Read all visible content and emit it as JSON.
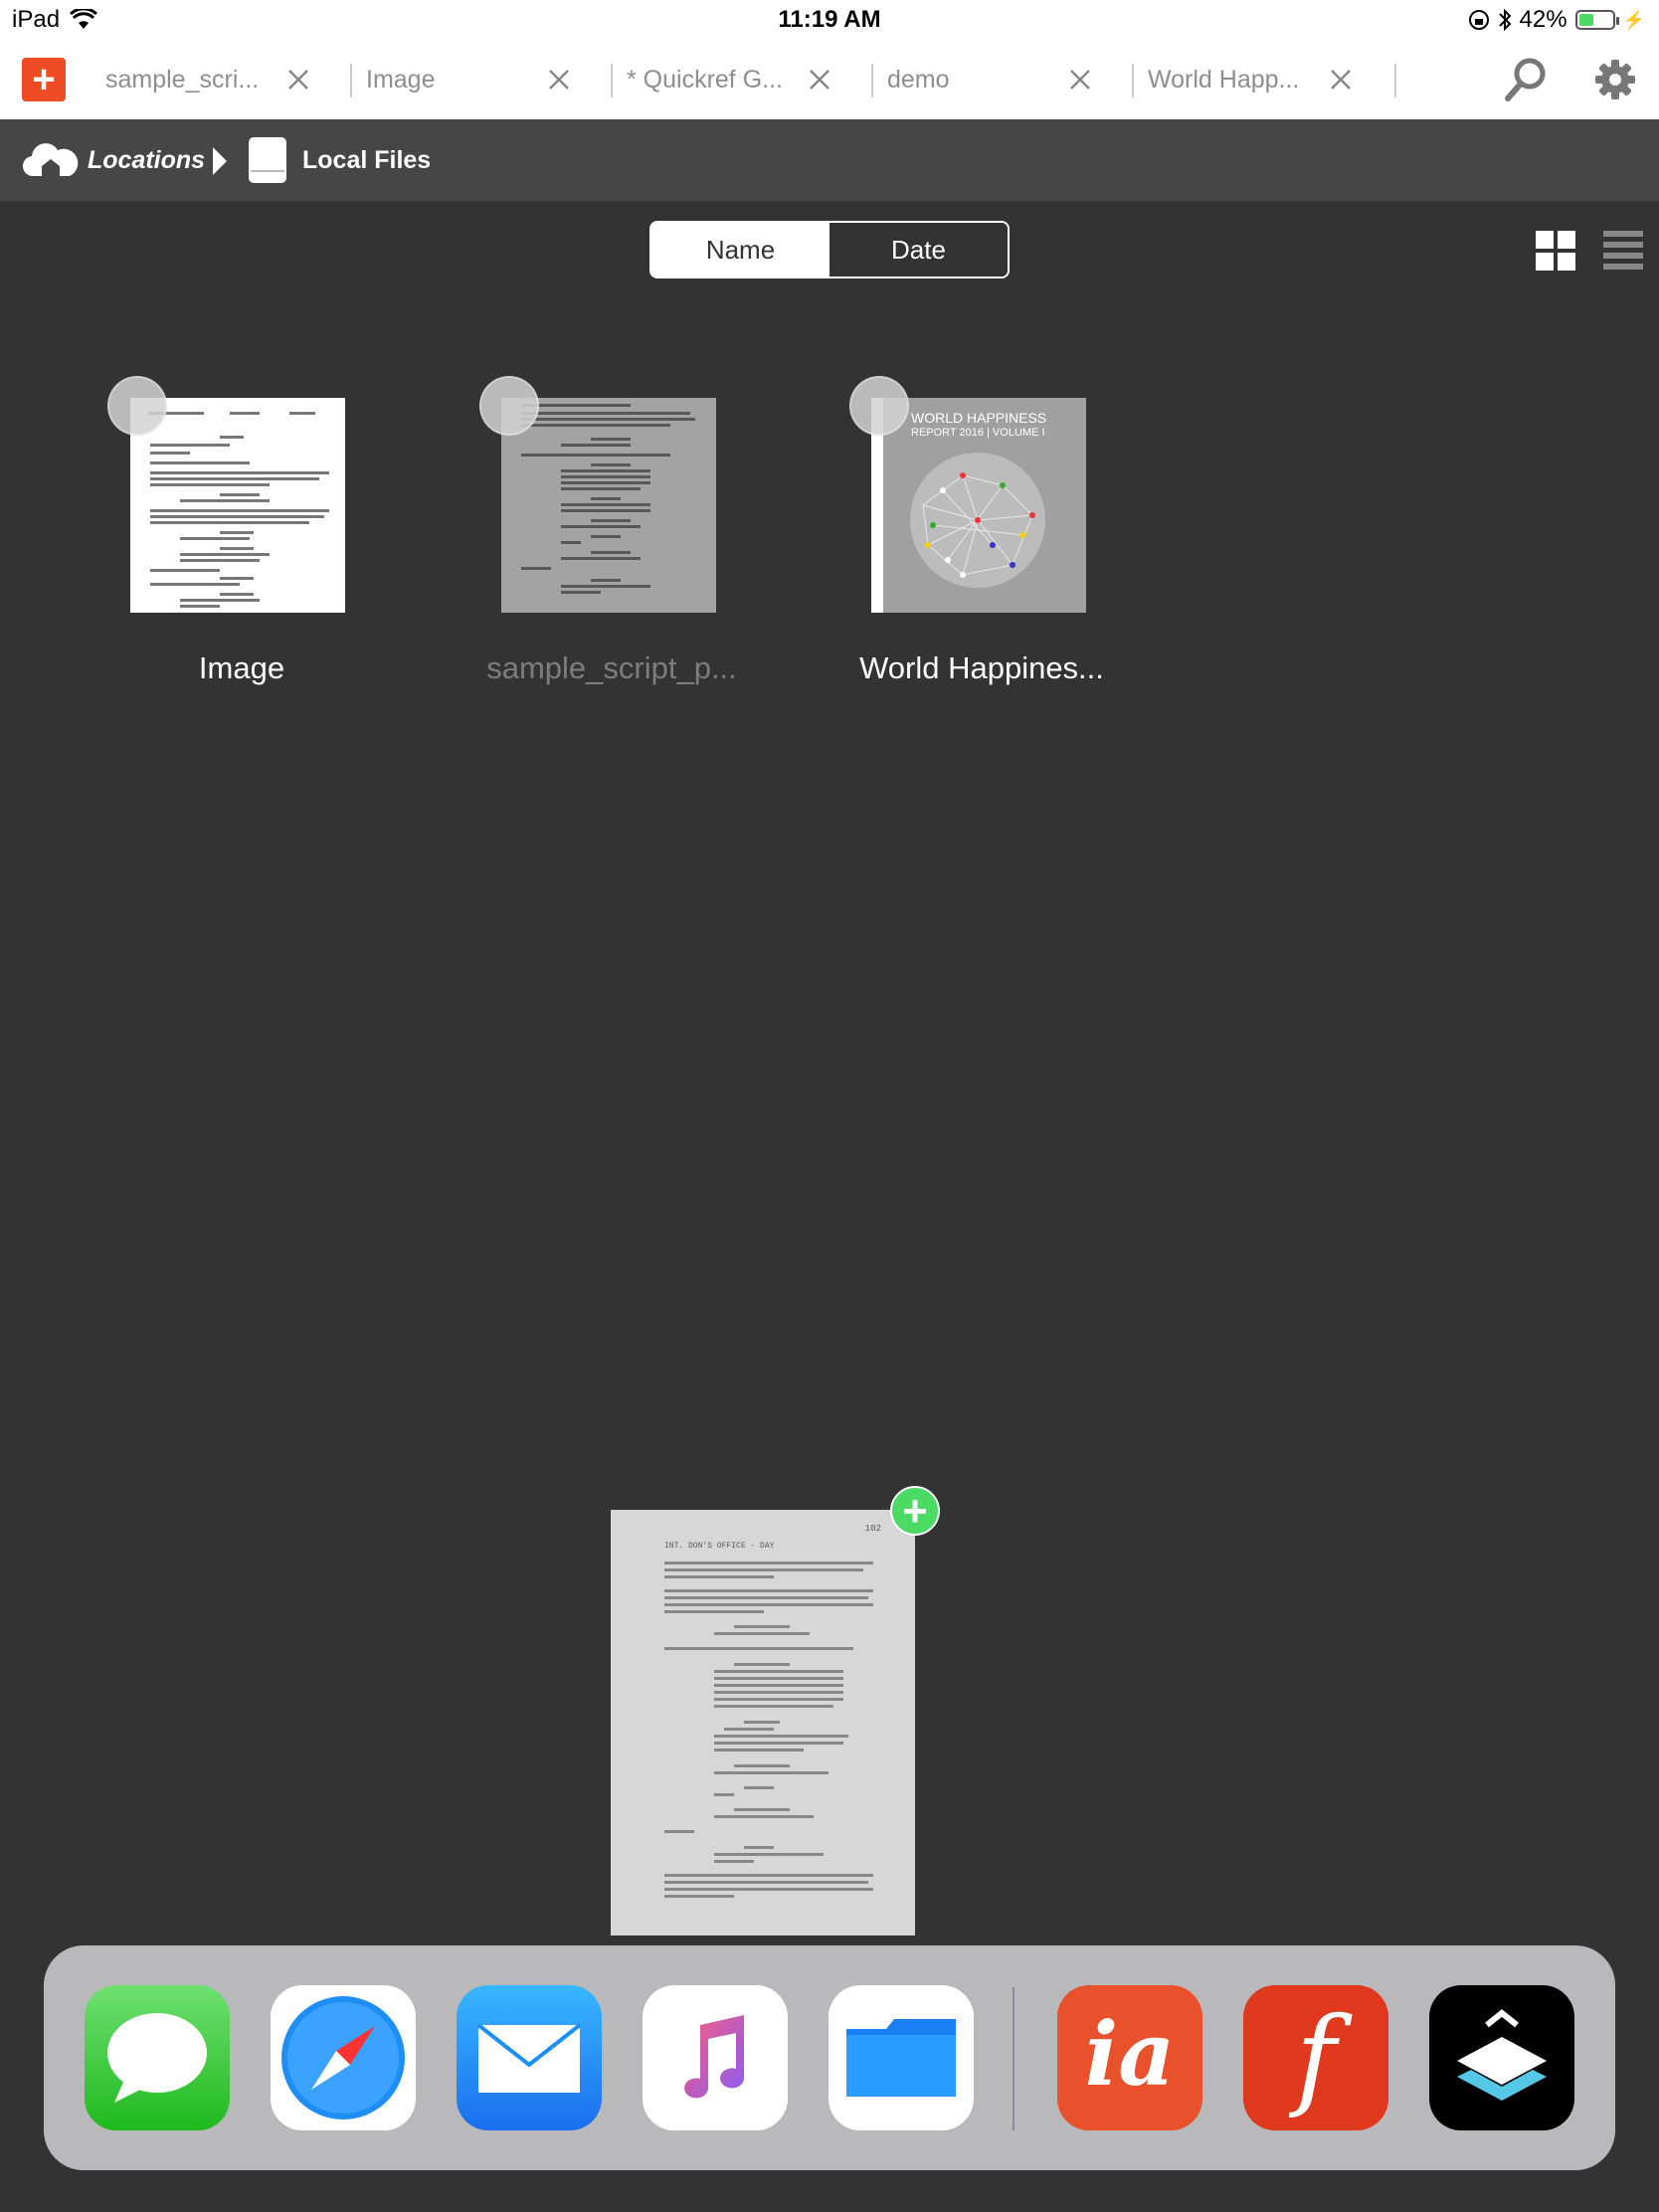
{
  "status_bar": {
    "device": "iPad",
    "time": "11:19 AM",
    "battery": "42%"
  },
  "tabs": [
    {
      "label": "sample_scri..."
    },
    {
      "label": "Image"
    },
    {
      "label": "* Quickref G..."
    },
    {
      "label": "demo"
    },
    {
      "label": "World Happ..."
    }
  ],
  "breadcrumb": {
    "locations": "Locations",
    "current": "Local Files"
  },
  "sort": {
    "name": "Name",
    "date": "Date",
    "selected": "Name"
  },
  "files": [
    {
      "name": "Image",
      "icon": "screenplay-page-thumbnail"
    },
    {
      "name": "sample_script_p...",
      "icon": "screenplay-page-thumbnail",
      "dimmed": true
    },
    {
      "name": "World Happines...",
      "icon": "report-cover-thumbnail",
      "cover_title": "WORLD HAPPINESS",
      "cover_subtitle": "REPORT 2016 | VOLUME I"
    }
  ],
  "drag_preview": {
    "page_number": "102",
    "heading": "INT. DON'S OFFICE - DAY"
  },
  "dock": {
    "apps": [
      "messages-icon",
      "safari-icon",
      "mail-icon",
      "music-icon",
      "files-icon",
      "ia-writer-icon",
      "fade-in-icon",
      "buffer-icon"
    ]
  },
  "colors": {
    "accent": "#ef4b25",
    "background": "#333333",
    "breadcrumb_bar": "#464646",
    "add_badge": "#4cd964"
  }
}
